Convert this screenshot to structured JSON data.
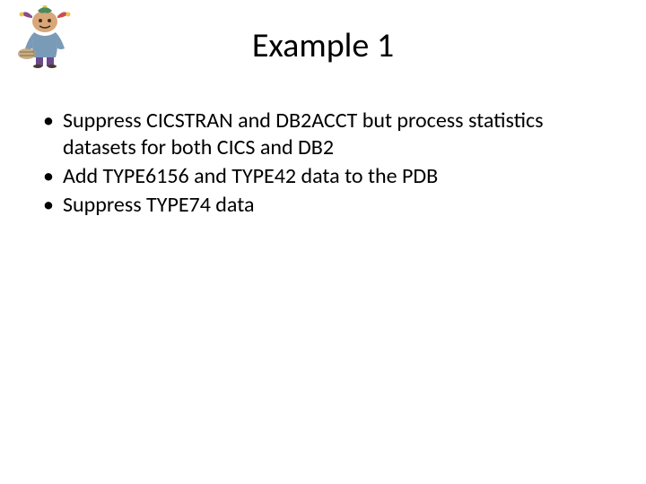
{
  "header": {
    "title": "Example 1",
    "decorative_icon": "wizard-jester-clipart"
  },
  "content": {
    "bullets": [
      "Suppress CICSTRAN and DB2ACCT but process statistics datasets for both CICS and DB2",
      "Add TYPE6156 and TYPE42 data to the PDB",
      "Suppress TYPE74 data"
    ]
  }
}
